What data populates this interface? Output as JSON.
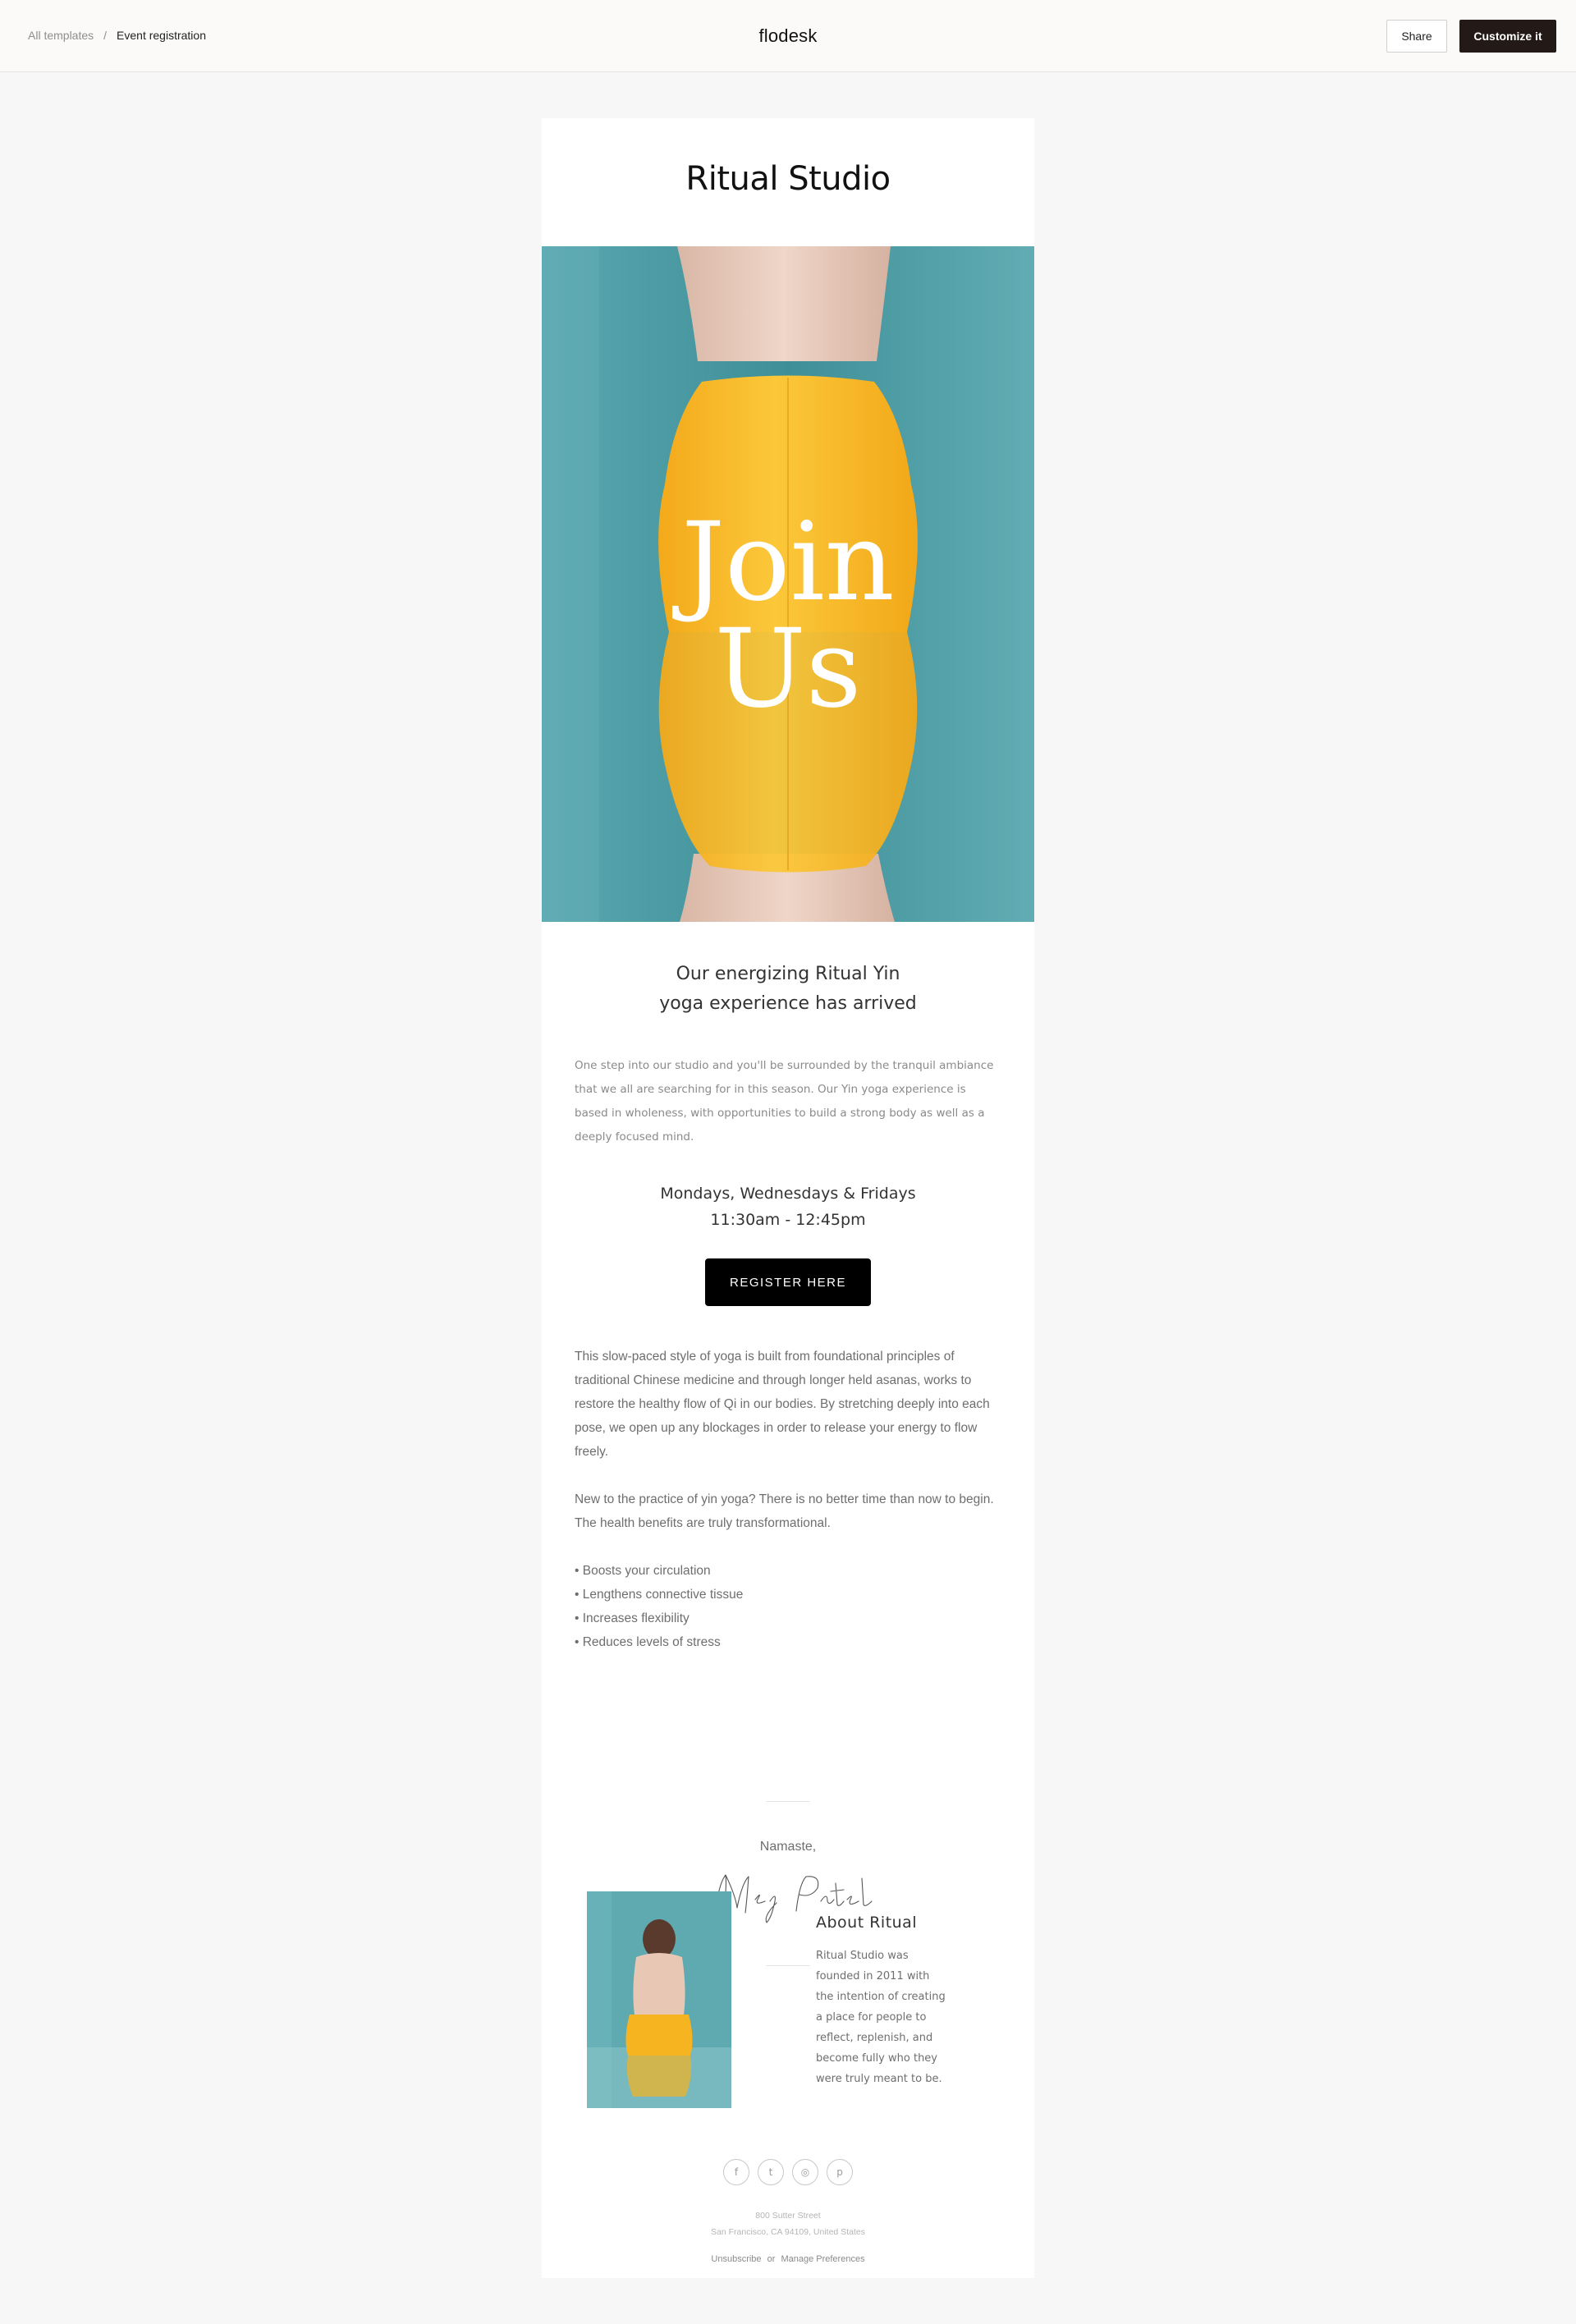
{
  "topbar": {
    "breadcrumb_root": "All templates",
    "breadcrumb_sep": "/",
    "breadcrumb_current": "Event registration",
    "brand": "flodesk",
    "share_label": "Share",
    "customize_label": "Customize it"
  },
  "email": {
    "studio_title": "Ritual Studio",
    "hero": {
      "line1": "Join",
      "line2": "Us"
    },
    "headline": {
      "line1": "Our energizing Ritual Yin",
      "line2": "yoga experience has arrived"
    },
    "intro": "One step into our studio and you'll be surrounded by the tranquil ambiance that we all are searching for in this season. Our Yin yoga experience is based in wholeness, with opportunities to build a strong body as well as a deeply focused mind.",
    "schedule": {
      "days": "Mondays, Wednesdays & Fridays",
      "time": "11:30am - 12:45pm"
    },
    "register_label": "REGISTER HERE",
    "body_p1": "This slow-paced style of yoga is built from foundational principles of traditional Chinese medicine and through longer held asanas, works to restore the healthy flow of Qi in our bodies. By stretching deeply into each pose, we open up any blockages in order to release your energy to flow freely.",
    "body_p2": "New to the practice of yin yoga? There is no better time than now to begin. The health benefits are truly transformational.",
    "bullets": [
      "• Boosts your circulation",
      "• Lengthens connective tissue",
      "• Increases flexibility",
      "• Reduces levels of stress"
    ],
    "signoff": "Namaste,",
    "signature": "Meg Patel",
    "about": {
      "title": "About Ritual",
      "text": "Ritual Studio was founded in 2011 with the intention of creating a place for people to reflect, replenish, and become fully who they were truly meant to be."
    },
    "socials": [
      {
        "icon": "facebook-icon",
        "glyph": "f"
      },
      {
        "icon": "twitter-icon",
        "glyph": "t"
      },
      {
        "icon": "instagram-icon",
        "glyph": "◎"
      },
      {
        "icon": "pinterest-icon",
        "glyph": "p"
      }
    ],
    "address": {
      "line1": "800 Sutter Street",
      "line2": "San Francisco, CA 94109, United States"
    },
    "footer": {
      "unsubscribe": "Unsubscribe",
      "or": "or",
      "manage": "Manage Preferences"
    }
  },
  "colors": {
    "teal": "#5fa9b1",
    "yellow": "#f6b81e",
    "dark_button": "#231a18"
  }
}
